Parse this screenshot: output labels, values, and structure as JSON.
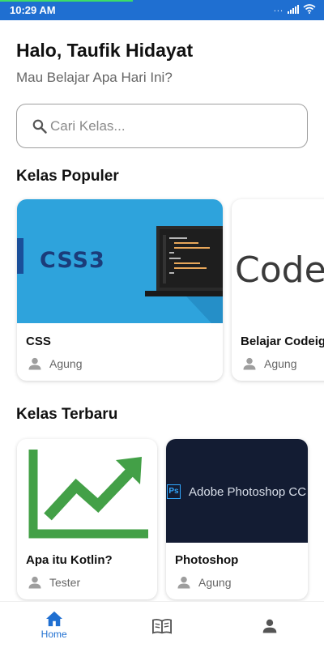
{
  "status": {
    "time": "10:29 AM",
    "dots": "...",
    "color": "#1f6fd1"
  },
  "header": {
    "greeting": "Halo, Taufik Hidayat",
    "subtitle": "Mau Belajar Apa Hari Ini?"
  },
  "search": {
    "placeholder": "Cari Kelas...",
    "icon": "search-icon"
  },
  "popular": {
    "title": "Kelas Populer",
    "cards": [
      {
        "title": "CSS",
        "author": "Agung",
        "image_text": "CSS3"
      },
      {
        "title": "Belajar Codeigniter",
        "author": "Agung",
        "image_text": "Code"
      }
    ]
  },
  "newest": {
    "title": "Kelas Terbaru",
    "cards": [
      {
        "title": "Apa itu Kotlin?",
        "author": "Tester"
      },
      {
        "title": "Photoshop",
        "author": "Agung",
        "image_text": "Adobe Photoshop CC",
        "badge": "Ps"
      }
    ]
  },
  "nav": {
    "home_label": "Home",
    "active_color": "#1f6fd1"
  }
}
